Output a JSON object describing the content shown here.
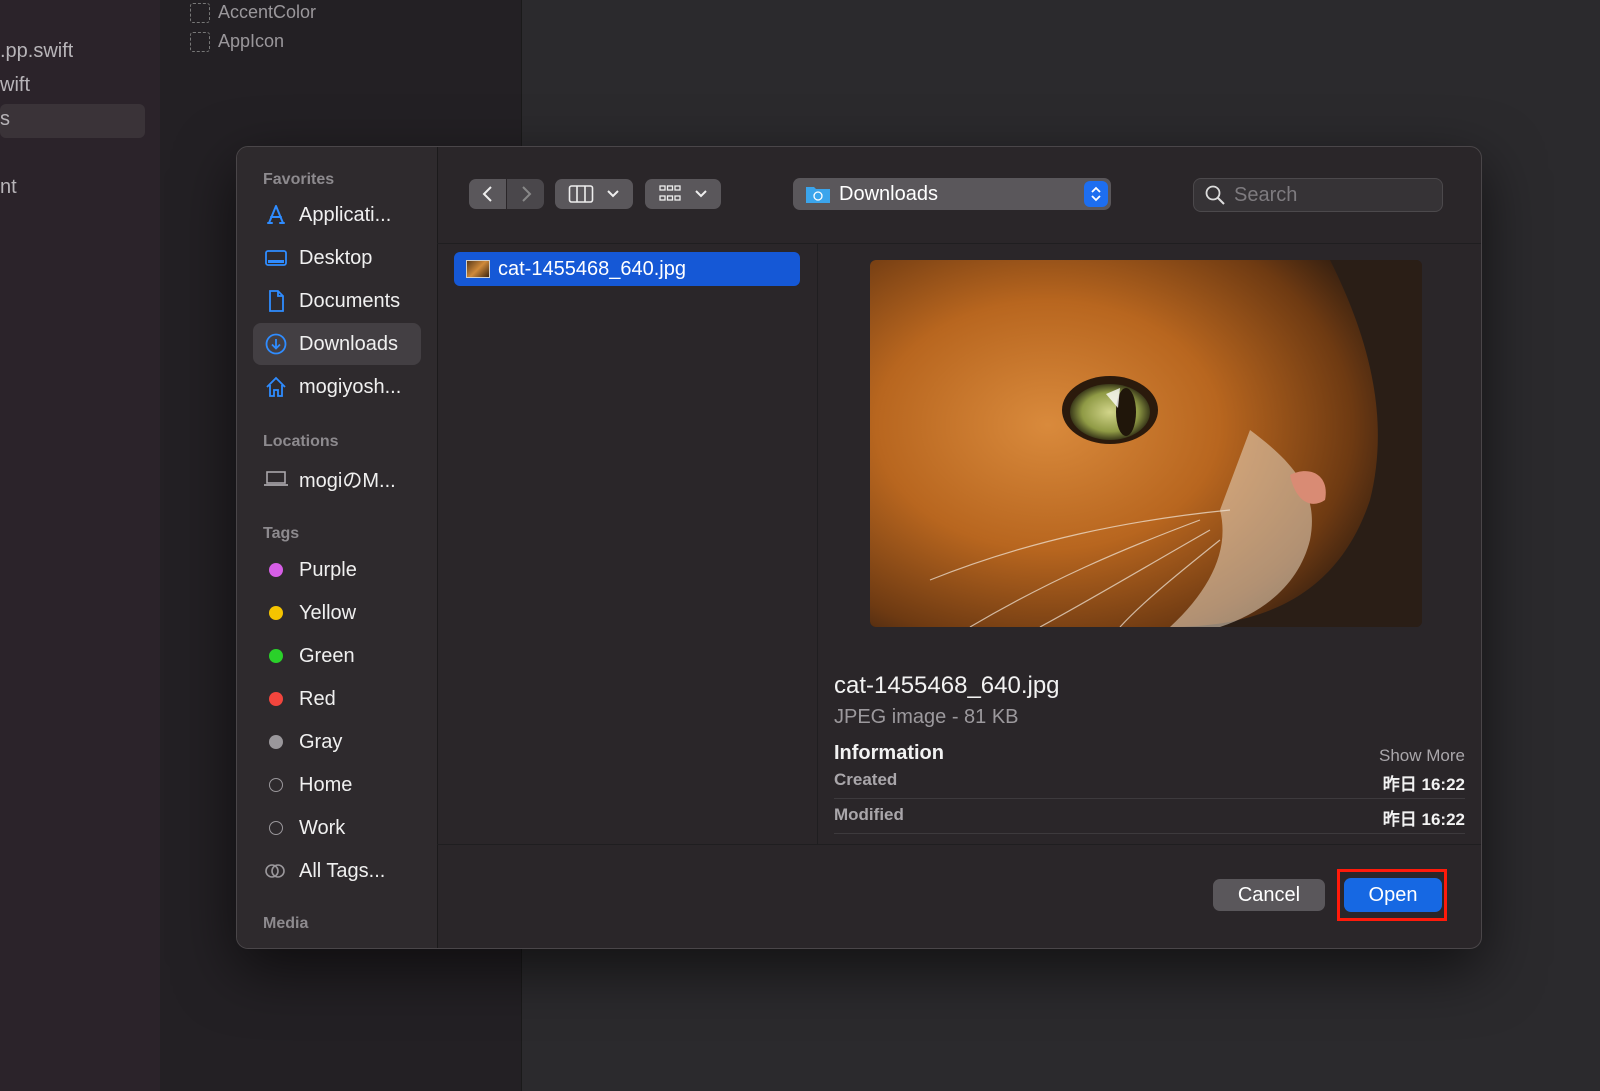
{
  "background": {
    "files": [
      ".pp.swift",
      "wift",
      "s",
      "nt"
    ],
    "assets": [
      "AccentColor",
      "AppIcon"
    ]
  },
  "sidebar": {
    "favorites_heading": "Favorites",
    "favorites": [
      {
        "label": "Applicati...",
        "icon": "applications-icon"
      },
      {
        "label": "Desktop",
        "icon": "desktop-icon"
      },
      {
        "label": "Documents",
        "icon": "documents-icon"
      },
      {
        "label": "Downloads",
        "icon": "downloads-icon",
        "selected": true
      },
      {
        "label": "mogiyosh...",
        "icon": "home-icon"
      }
    ],
    "locations_heading": "Locations",
    "locations": [
      {
        "label": "mogiのM...",
        "icon": "laptop-icon"
      }
    ],
    "tags_heading": "Tags",
    "tags": [
      {
        "label": "Purple",
        "color": "#d65ee6"
      },
      {
        "label": "Yellow",
        "color": "#f5c400"
      },
      {
        "label": "Green",
        "color": "#2ad12a"
      },
      {
        "label": "Red",
        "color": "#f2453d"
      },
      {
        "label": "Gray",
        "color": "#9a979b"
      },
      {
        "label": "Home",
        "color": "hollow"
      },
      {
        "label": "Work",
        "color": "hollow"
      },
      {
        "label": "All Tags...",
        "color": "all"
      }
    ],
    "media_heading": "Media"
  },
  "toolbar": {
    "location": "Downloads",
    "search_placeholder": "Search"
  },
  "files": [
    {
      "name": "cat-1455468_640.jpg",
      "selected": true
    }
  ],
  "preview": {
    "name": "cat-1455468_640.jpg",
    "kind": "JPEG image - 81 KB",
    "info_heading": "Information",
    "show_more": "Show More",
    "rows": [
      {
        "key": "Created",
        "value": "昨日 16:22"
      },
      {
        "key": "Modified",
        "value": "昨日 16:22"
      }
    ]
  },
  "footer": {
    "cancel": "Cancel",
    "open": "Open"
  },
  "colors": {
    "accent": "#1668e3",
    "highlight_frame": "#ff1a0a"
  }
}
